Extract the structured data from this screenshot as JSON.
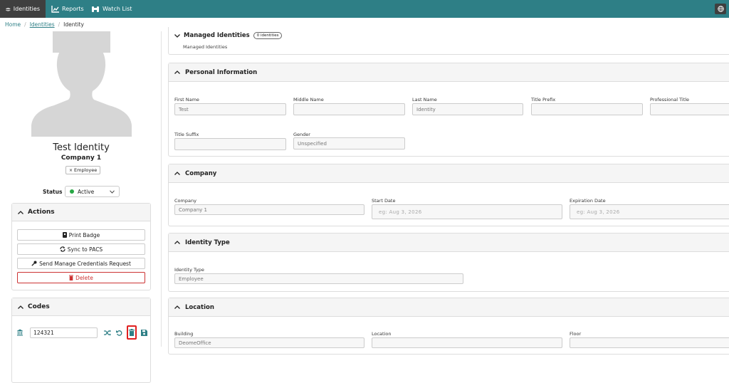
{
  "nav": {
    "items": [
      {
        "label": "Identities"
      },
      {
        "label": "Reports"
      },
      {
        "label": "Watch List"
      }
    ]
  },
  "breadcrumb": {
    "home": "Home",
    "identities": "Identities",
    "current": "Identity"
  },
  "profile": {
    "name": "Test Identity",
    "company": "Company 1",
    "tag": "Employee",
    "status_label": "Status",
    "status_value": "Active"
  },
  "actions": {
    "title": "Actions",
    "print_badge": "Print Badge",
    "sync": "Sync to PACS",
    "send_request": "Send Manage Credentials Request",
    "delete": "Delete"
  },
  "codes": {
    "title": "Codes",
    "value": "124321"
  },
  "managed": {
    "title": "Managed Identities",
    "badge": "0 identities",
    "subtitle": "Managed Identities"
  },
  "personal": {
    "title": "Personal Information",
    "first_name_label": "First Name",
    "first_name": "Test",
    "middle_name_label": "Middle Name",
    "middle_name": "",
    "last_name_label": "Last Name",
    "last_name": "Identity",
    "title_prefix_label": "Title Prefix",
    "title_prefix": "",
    "professional_title_label": "Professional Title",
    "professional_title": "",
    "title_suffix_label": "Title Suffix",
    "title_suffix": "",
    "gender_label": "Gender",
    "gender": "Unspecified"
  },
  "company": {
    "title": "Company",
    "company_label": "Company",
    "company_value": "Company 1",
    "start_label": "Start Date",
    "start_placeholder": "eg: Aug 3, 2026",
    "expiration_label": "Expiration Date",
    "expiration_placeholder": "eg: Aug 3, 2026"
  },
  "identity_type": {
    "title": "Identity Type",
    "label": "Identity Type",
    "value": "Employee"
  },
  "location": {
    "title": "Location",
    "building_label": "Building",
    "building_value": "DeomeOffice",
    "location_label": "Location",
    "floor_label": "Floor"
  },
  "colors": {
    "nav_bg": "#2e7f86",
    "active_nav": "#3f3f3f",
    "danger": "#cc3333",
    "highlight": "#e02020",
    "status_dot": "#28a745"
  }
}
